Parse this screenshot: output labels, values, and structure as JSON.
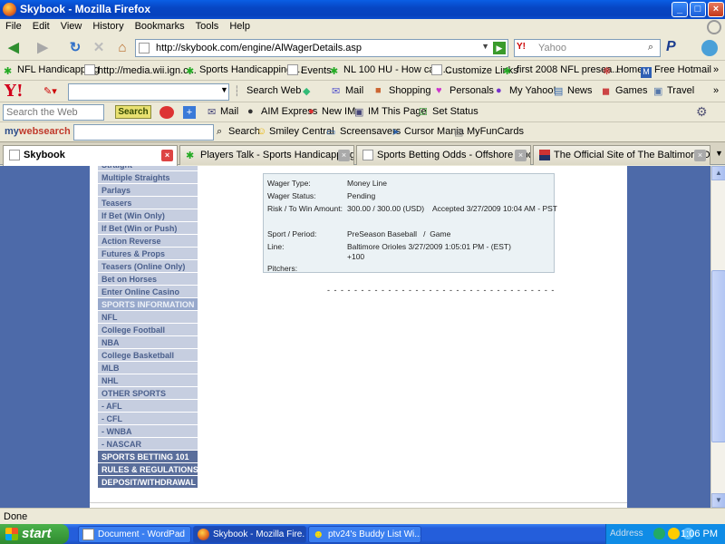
{
  "window": {
    "title": "Skybook - Mozilla Firefox",
    "buttons": {
      "minimize": "_",
      "maximize": "□",
      "close": "×"
    }
  },
  "menubar": [
    "File",
    "Edit",
    "View",
    "History",
    "Bookmarks",
    "Tools",
    "Help"
  ],
  "navigation": {
    "url": "http://skybook.com/engine/AlWagerDetails.asp",
    "search_engine": "Y!",
    "search_placeholder": "Yahoo",
    "search_icon": "magnifier-icon",
    "extra_icon": "paypal-icon"
  },
  "bookmarks": [
    "NFL Handicapping",
    "http://media.wii.ign.c...",
    "Sports Handicapping,...",
    "Events",
    "NL 100 HU - How can ...",
    "Customize Links",
    "first 2008 NFL presea...",
    "Home",
    "Free Hotmail"
  ],
  "yahoo_toolbar": {
    "logo": "Y!",
    "search_web": "Search Web",
    "items": [
      "Mail",
      "Shopping",
      "Personals",
      "My Yahoo!",
      "News",
      "Games",
      "Travel"
    ]
  },
  "aim_toolbar": {
    "search_placeholder": "Search the Web",
    "search_button": "Search",
    "items": [
      "Mail",
      "AIM Express",
      "New IM",
      "IM This Page",
      "Set Status"
    ]
  },
  "mywebsearch_toolbar": {
    "logo_prefix": "my",
    "logo_main": "websearch",
    "search_button": "Search",
    "items": [
      "Smiley Central",
      "Screensavers",
      "Cursor Mania",
      "MyFunCards"
    ]
  },
  "tabs": [
    {
      "label": "Skybook",
      "active": true
    },
    {
      "label": "Players Talk - Sports Handicapping, Be...",
      "active": false
    },
    {
      "label": "Sports Betting Odds - Offshore Sports...",
      "active": false
    },
    {
      "label": "The Official Site of The Baltimore Oriol...",
      "active": false
    }
  ],
  "side_menu": [
    {
      "label": "Straight",
      "style": "normal"
    },
    {
      "label": "Multiple Straights",
      "style": "normal"
    },
    {
      "label": "Parlays",
      "style": "normal"
    },
    {
      "label": "Teasers",
      "style": "normal"
    },
    {
      "label": "If Bet (Win Only)",
      "style": "normal"
    },
    {
      "label": "If Bet (Win or Push)",
      "style": "normal"
    },
    {
      "label": "Action Reverse",
      "style": "normal"
    },
    {
      "label": "Futures & Props",
      "style": "normal"
    },
    {
      "label": "Teasers (Online Only)",
      "style": "normal"
    },
    {
      "label": "Bet on Horses",
      "style": "normal"
    },
    {
      "label": "Enter Online Casino",
      "style": "normal"
    },
    {
      "label": "SPORTS INFORMATION",
      "style": "header"
    },
    {
      "label": "NFL",
      "style": "normal"
    },
    {
      "label": "College Football",
      "style": "normal"
    },
    {
      "label": "NBA",
      "style": "normal"
    },
    {
      "label": "College Basketball",
      "style": "normal"
    },
    {
      "label": "MLB",
      "style": "normal"
    },
    {
      "label": "NHL",
      "style": "normal"
    },
    {
      "label": "OTHER SPORTS",
      "style": "normal"
    },
    {
      "label": "- AFL",
      "style": "normal"
    },
    {
      "label": "- CFL",
      "style": "normal"
    },
    {
      "label": "- WNBA",
      "style": "normal"
    },
    {
      "label": "- NASCAR",
      "style": "normal"
    },
    {
      "label": "SPORTS BETTING 101",
      "style": "dark"
    },
    {
      "label": "RULES & REGULATIONS",
      "style": "dark"
    },
    {
      "label": "DEPOSIT/WITHDRAWAL",
      "style": "dark"
    }
  ],
  "wager": {
    "type_label": "Wager Type:",
    "type_value": "Money Line",
    "status_label": "Wager Status:",
    "status_value": "Pending",
    "risk_label": "Risk / To Win Amount:",
    "risk_value": "300.00 / 300.00 (USD)",
    "accepted": "Accepted 3/27/2009 10:04 AM - PST",
    "sport_label": "Sport / Period:",
    "sport_value": "PreSeason Baseball   /  Game",
    "line_label": "Line:",
    "line_value": "Baltimore Orioles  3/27/2009 1:05:01 PM - (EST)",
    "line_odds": "+100",
    "pitchers_label": "Pitchers:"
  },
  "separator": "- - - - - - - - - - - - - - - - - - - - - - - - - - - - - - - - - -",
  "status": "Done",
  "taskbar": {
    "start": "start",
    "tasks": [
      "Document - WordPad",
      "Skybook - Mozilla Fire...",
      "ptv24's Buddy List Wi..."
    ],
    "address_label": "Address",
    "clock": "1:06 PM"
  }
}
